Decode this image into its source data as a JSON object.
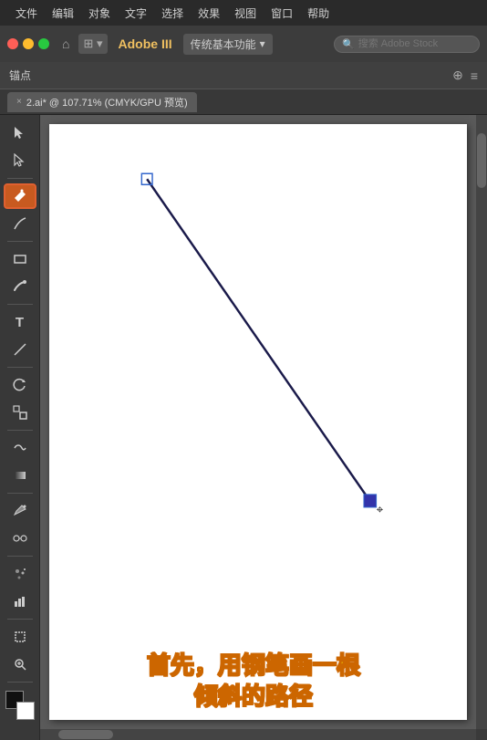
{
  "menubar": {
    "items": [
      "文件",
      "编辑",
      "对象",
      "文字",
      "选择",
      "效果",
      "视图",
      "窗口",
      "帮助"
    ]
  },
  "toolbar": {
    "brand": "Adobe III",
    "preset": "传统基本功能",
    "preset_arrow": "▾",
    "search_placeholder": "搜索 Adobe Stock"
  },
  "anchors_bar": {
    "label": "锚点"
  },
  "tabbar": {
    "tab_label": "2.ai* @ 107.71% (CMYK/GPU 预览)",
    "close": "×"
  },
  "tools": [
    {
      "name": "select",
      "icon": "▶"
    },
    {
      "name": "direct-select",
      "icon": "▷"
    },
    {
      "name": "pen",
      "icon": "✒"
    },
    {
      "name": "pencil",
      "icon": "✏"
    },
    {
      "name": "rect",
      "icon": "□"
    },
    {
      "name": "brush",
      "icon": "/"
    },
    {
      "name": "type",
      "icon": "T"
    },
    {
      "name": "line",
      "icon": "\\"
    },
    {
      "name": "rotate",
      "icon": "↺"
    },
    {
      "name": "scale",
      "icon": "⤡"
    },
    {
      "name": "warp",
      "icon": "⌇"
    },
    {
      "name": "gradient",
      "icon": "▣"
    },
    {
      "name": "eyedropper",
      "icon": "⌀"
    },
    {
      "name": "blend",
      "icon": "⇌"
    },
    {
      "name": "symbol",
      "icon": "❋"
    },
    {
      "name": "column-graph",
      "icon": "▦"
    },
    {
      "name": "artboard",
      "icon": "⬜"
    },
    {
      "name": "zoom",
      "icon": "🔍"
    },
    {
      "name": "hand",
      "icon": "✋"
    }
  ],
  "annotation": {
    "line1": "首先，用钢笔画一根",
    "line2": "倾斜的路径"
  }
}
